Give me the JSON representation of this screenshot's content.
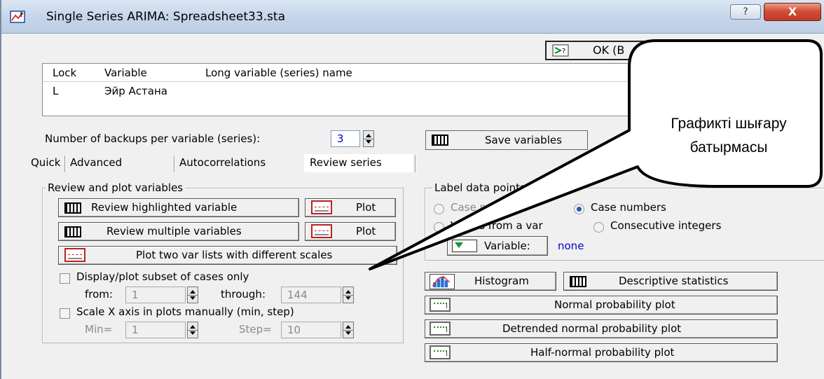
{
  "window": {
    "title": "Single Series ARIMA: Spreadsheet33.sta",
    "help_label": "?",
    "close_label": "X"
  },
  "ok_button": {
    "label": "OK (B"
  },
  "variable_table": {
    "headers": [
      "Lock",
      "Variable",
      "Long variable (series) name"
    ],
    "rows": [
      {
        "lock": "L",
        "variable": "Эйр Астана",
        "long_name": ""
      }
    ]
  },
  "backups": {
    "label": "Number of backups per variable (series):",
    "value": "3"
  },
  "save_variables": {
    "label": "Save variables"
  },
  "tabs": [
    {
      "label": "Quick",
      "active": false
    },
    {
      "label": "Advanced",
      "active": false
    },
    {
      "label": "Autocorrelations",
      "active": false
    },
    {
      "label": "Review series",
      "active": true
    }
  ],
  "review_group": {
    "title": "Review and plot variables",
    "review_highlighted": "Review highlighted variable",
    "plot_1": "Plot",
    "review_multiple": "Review multiple variables",
    "plot_2": "Plot",
    "plot_two_lists": "Plot two var lists with different scales",
    "display_subset_label": "Display/plot subset of cases only",
    "from_label": "from:",
    "from_value": "1",
    "through_label": "through:",
    "through_value": "144",
    "scale_x_label": "Scale X axis in plots manually (min, step)",
    "min_label": "Min=",
    "min_value": "1",
    "step_label": "Step=",
    "step_value": "10"
  },
  "label_group": {
    "title": "Label data points with",
    "case_names": "Case names",
    "case_numbers": "Case numbers",
    "values_from_var": "Values from a var",
    "consecutive_integers": "Consecutive integers",
    "variable_button": "Variable:",
    "variable_value": "none",
    "selected": "Case numbers"
  },
  "stats_buttons": {
    "histogram": "Histogram",
    "descriptive": "Descriptive statistics",
    "normal_prob": "Normal probability plot",
    "detrended": "Detrended normal probability plot",
    "half_normal": "Half-normal probability plot"
  },
  "callout": {
    "line1": "Графикті  шығару",
    "line2": "батырмасы"
  },
  "colors": {
    "dialog_bg": "#f0f0f0",
    "title_bar": "#c7d6ea",
    "close_red": "#c0392b",
    "value_blue": "#0000cc",
    "radio_blue": "#1e5fb4"
  }
}
